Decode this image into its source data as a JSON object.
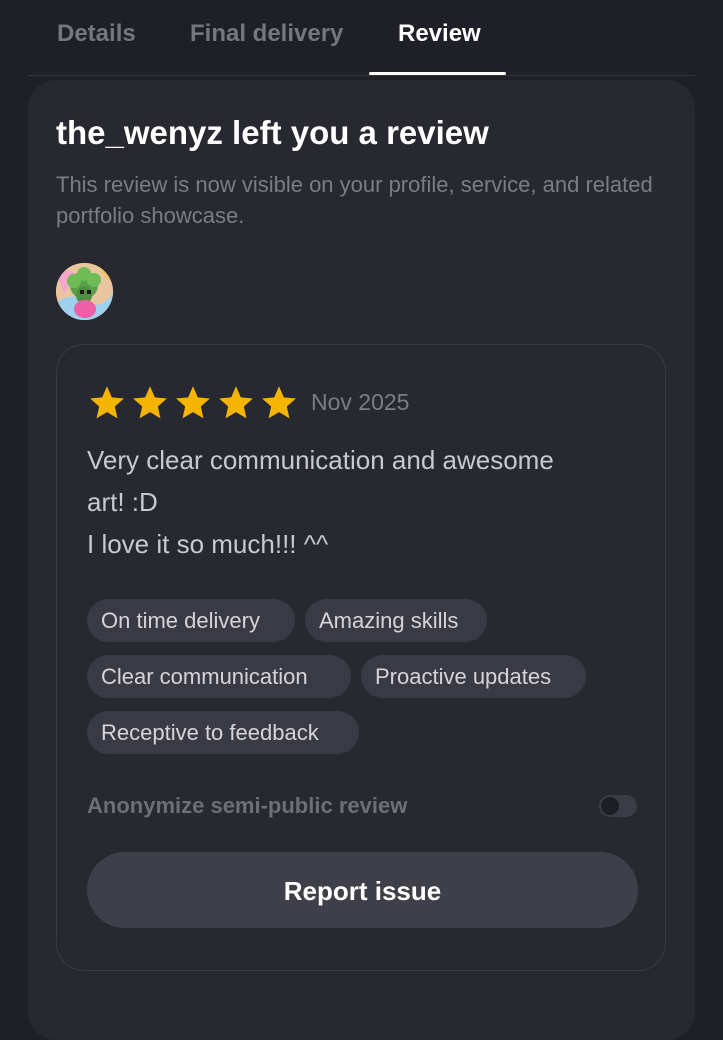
{
  "tabs": [
    {
      "label": "Details"
    },
    {
      "label": "Final delivery"
    },
    {
      "label": "Review"
    }
  ],
  "active_tab": "Review",
  "review_card": {
    "title": "the_wenyz left you a review",
    "subtitle": "This review is now visible on your profile, service, and related portfolio showcase.",
    "reviewer_avatar_icon": "avatar-illustration"
  },
  "review": {
    "rating": 5,
    "rating_max": 5,
    "star_color": "#f5b400",
    "date": "Nov 2025",
    "text_lines": [
      "Very clear communication and awesome",
      "art! :D",
      "I love it so much!!! ^^"
    ],
    "tags": [
      "On time delivery",
      "Amazing skills",
      "Clear communication",
      "Proactive updates",
      "Receptive to feedback"
    ]
  },
  "anonymize": {
    "label": "Anonymize semi-public review",
    "enabled": false
  },
  "report_button": {
    "label": "Report issue"
  }
}
